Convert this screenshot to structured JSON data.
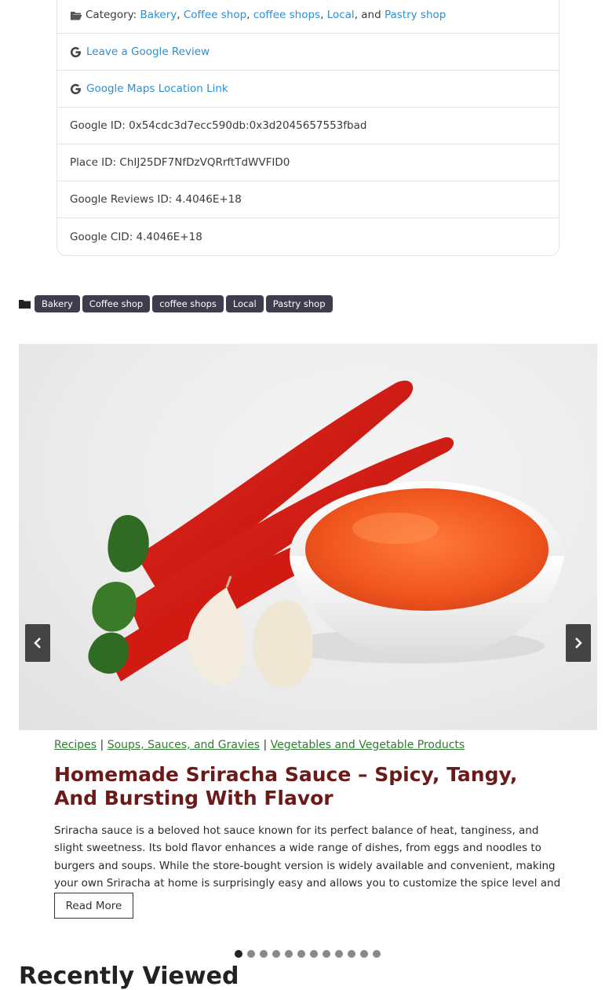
{
  "details": {
    "category_label": "Category:",
    "categories": [
      "Bakery",
      "Coffee shop",
      "coffee shops",
      "Local",
      "Pastry shop"
    ],
    "and_word": ", and ",
    "review_link": "Leave a Google Review",
    "maps_link": "Google Maps Location Link",
    "google_id": "Google ID: 0x54cdc3d7ecc590db:0x3d2045657553fbad",
    "place_id": "Place ID: ChIJ25DF7NfDzVQRrftTdWVFID0",
    "reviews_id": "Google Reviews ID: 4.4046E+18",
    "cid": "Google CID: 4.4046E+18"
  },
  "tags": [
    "Bakery",
    "Coffee shop",
    "coffee shops",
    "Local",
    "Pastry shop"
  ],
  "slider": {
    "image_icon": "sriracha-chili-garlic-image",
    "prev_icon": "chevron-left-icon",
    "next_icon": "chevron-right-icon",
    "post_categories": [
      "Recipes",
      "Soups, Sauces, and Gravies",
      "Vegetables and Vegetable Products"
    ],
    "category_separator": "|",
    "title": "Homemade Sriracha Sauce – Spicy, Tangy, And Bursting With Flavor",
    "excerpt": "Sriracha sauce is a beloved hot sauce known for its perfect balance of heat, tanginess, and slight sweetness. Its bold flavor enhances a wide range of dishes, from eggs and noodles to burgers and soups. While the store-bought version is widely available and convenient, making your own Sriracha at home is surprisingly easy and allows you to customize the spice level and flavor to...",
    "read_more": "Read More",
    "dot_count": 12,
    "active_dot": 1
  },
  "next_section": {
    "heading": "Recently Viewed"
  },
  "colors": {
    "link": "#2e8fd3",
    "tag_bg": "#3d3d4e",
    "title": "#6b1a1a",
    "category_link": "#2e7d32"
  }
}
